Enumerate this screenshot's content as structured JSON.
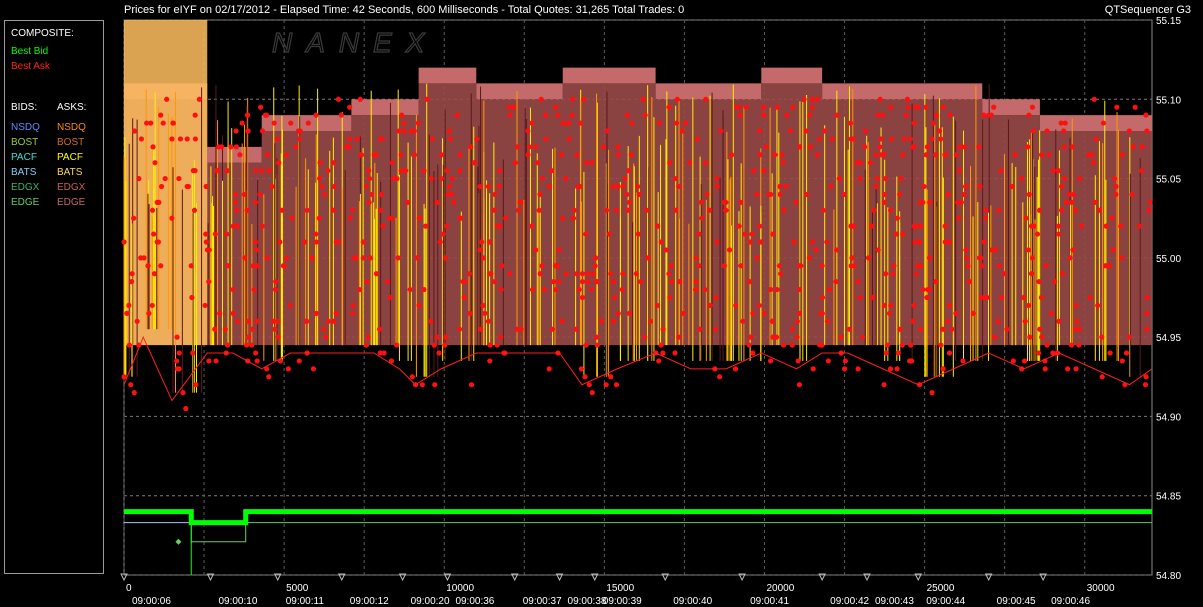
{
  "header": {
    "title": "Prices for  eIYF  on  02/17/2012  -  Elapsed Time: 42 Seconds, 600 Milliseconds  -  Total Quotes: 31,265  Total Trades: 0",
    "app_name": "QTSequencer G3"
  },
  "watermark": "NANEX",
  "legend": {
    "composite_header": "COMPOSITE:",
    "best_bid": "Best Bid",
    "best_ask": "Best Ask",
    "bids_header": "BIDS:",
    "asks_header": "ASKS:",
    "bids": [
      {
        "label": "NSDQ",
        "color": "#5b8cff"
      },
      {
        "label": "BOST",
        "color": "#9acd32"
      },
      {
        "label": "PACF",
        "color": "#40e0d0"
      },
      {
        "label": "BATS",
        "color": "#87cefa"
      },
      {
        "label": "EDGX",
        "color": "#3cb371"
      },
      {
        "label": "EDGE",
        "color": "#66cc66"
      }
    ],
    "asks": [
      {
        "label": "NSDQ",
        "color": "#ff8c00"
      },
      {
        "label": "BOST",
        "color": "#d2691e"
      },
      {
        "label": "PACF",
        "color": "#ffff00"
      },
      {
        "label": "BATS",
        "color": "#ffd966"
      },
      {
        "label": "EDGX",
        "color": "#cd5c5c"
      },
      {
        "label": "EDGE",
        "color": "#c86464"
      }
    ],
    "best_bid_color": "#00ff00",
    "best_ask_color": "#ff2020"
  },
  "chart_data": {
    "type": "line",
    "title": "Prices for  eIYF  on  02/17/2012",
    "x_ticks": [
      "0",
      "5000",
      "10000",
      "15000",
      "20000",
      "25000",
      "30000"
    ],
    "x_tick_values": [
      0,
      5000,
      10000,
      15000,
      20000,
      25000,
      30000
    ],
    "time_labels": [
      "09:00:06",
      "09:00:10",
      "09:00:11",
      "09:00:12",
      "09:00:20",
      "09:00:36",
      "09:00:37",
      "09:00:38",
      "09:00:39",
      "09:00:40",
      "09:00:41",
      "09:00:42",
      "09:00:43",
      "09:00:44",
      "09:00:45",
      "09:00:46"
    ],
    "time_label_x": [
      0,
      2700,
      4800,
      6800,
      8700,
      10100,
      12200,
      13600,
      14700,
      16900,
      19300,
      21800,
      23200,
      24800,
      27000,
      28700
    ],
    "y_ticks": [
      "55.15",
      "55.10",
      "55.05",
      "55.00",
      "54.95",
      "54.90",
      "54.85",
      "54.80"
    ],
    "y_tick_values": [
      55.15,
      55.1,
      55.05,
      55.0,
      54.95,
      54.9,
      54.85,
      54.8
    ],
    "xlim": [
      0,
      32100
    ],
    "ylim": [
      54.8,
      55.15
    ],
    "grid": true,
    "series": [
      {
        "name": "Best Bid",
        "color": "#00ff00",
        "x": [
          0,
          2100,
          2100,
          3800,
          3800,
          32100
        ],
        "y": [
          54.84,
          54.84,
          54.833,
          54.833,
          54.84,
          54.84
        ]
      },
      {
        "name": "Best Ask",
        "color": "#ff2020",
        "x": [
          0,
          600,
          1500,
          2600,
          3400,
          4300,
          5200,
          6500,
          7800,
          8600,
          9100,
          9900,
          11000,
          12400,
          13600,
          14300,
          15400,
          16600,
          17700,
          18800,
          19900,
          21000,
          21800,
          22600,
          23700,
          24800,
          25900,
          27000,
          28100,
          29200,
          30300,
          31400,
          32100
        ],
        "y": [
          54.92,
          54.95,
          54.91,
          54.94,
          54.94,
          54.93,
          54.94,
          54.94,
          54.94,
          54.93,
          54.92,
          54.93,
          54.94,
          54.94,
          54.94,
          54.92,
          54.93,
          54.94,
          54.93,
          54.93,
          54.94,
          54.93,
          54.94,
          54.94,
          54.93,
          54.92,
          54.93,
          54.94,
          54.93,
          54.94,
          54.93,
          54.92,
          54.93
        ]
      },
      {
        "name": "NSDQ",
        "color": "#cc6666",
        "x": [
          0,
          2600,
          2600,
          4300,
          4300,
          7100,
          7100,
          9200,
          9200,
          11000,
          11000,
          13700,
          13700,
          16600,
          16600,
          19900,
          19900,
          21800,
          21800,
          24000,
          24000,
          26800,
          26800,
          28600,
          28600,
          32100
        ],
        "y": [
          55.1,
          55.1,
          55.06,
          55.06,
          55.08,
          55.08,
          55.09,
          55.09,
          55.11,
          55.11,
          55.1,
          55.1,
          55.11,
          55.11,
          55.1,
          55.1,
          55.11,
          55.11,
          55.1,
          55.1,
          55.1,
          55.1,
          55.09,
          55.09,
          55.08,
          55.08
        ]
      }
    ],
    "annotations": {
      "nsdq_bid_level": 54.833,
      "edge_bid_level": 54.821
    }
  }
}
